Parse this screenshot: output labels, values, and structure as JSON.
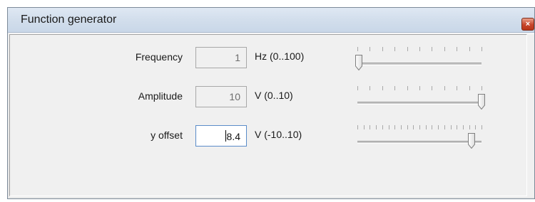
{
  "window": {
    "title": "Function generator",
    "close_glyph": "×"
  },
  "rows": [
    {
      "label": "Frequency",
      "value": "1",
      "unit": "Hz (0..100)",
      "min": 0,
      "max": 100,
      "current": 1,
      "active": false,
      "tick_count": 11
    },
    {
      "label": "Amplitude",
      "value": "10",
      "unit": "V (0..10)",
      "min": 0,
      "max": 10,
      "current": 10,
      "active": false,
      "tick_count": 11
    },
    {
      "label": "y offset",
      "value": "8.4",
      "unit": "V (-10..10)",
      "min": -10,
      "max": 10,
      "current": 8.4,
      "active": true,
      "tick_count": 21
    }
  ],
  "colors": {
    "titlebar": "#d2deec",
    "close_button": "#c7452b",
    "active_border": "#5a8cc9"
  }
}
